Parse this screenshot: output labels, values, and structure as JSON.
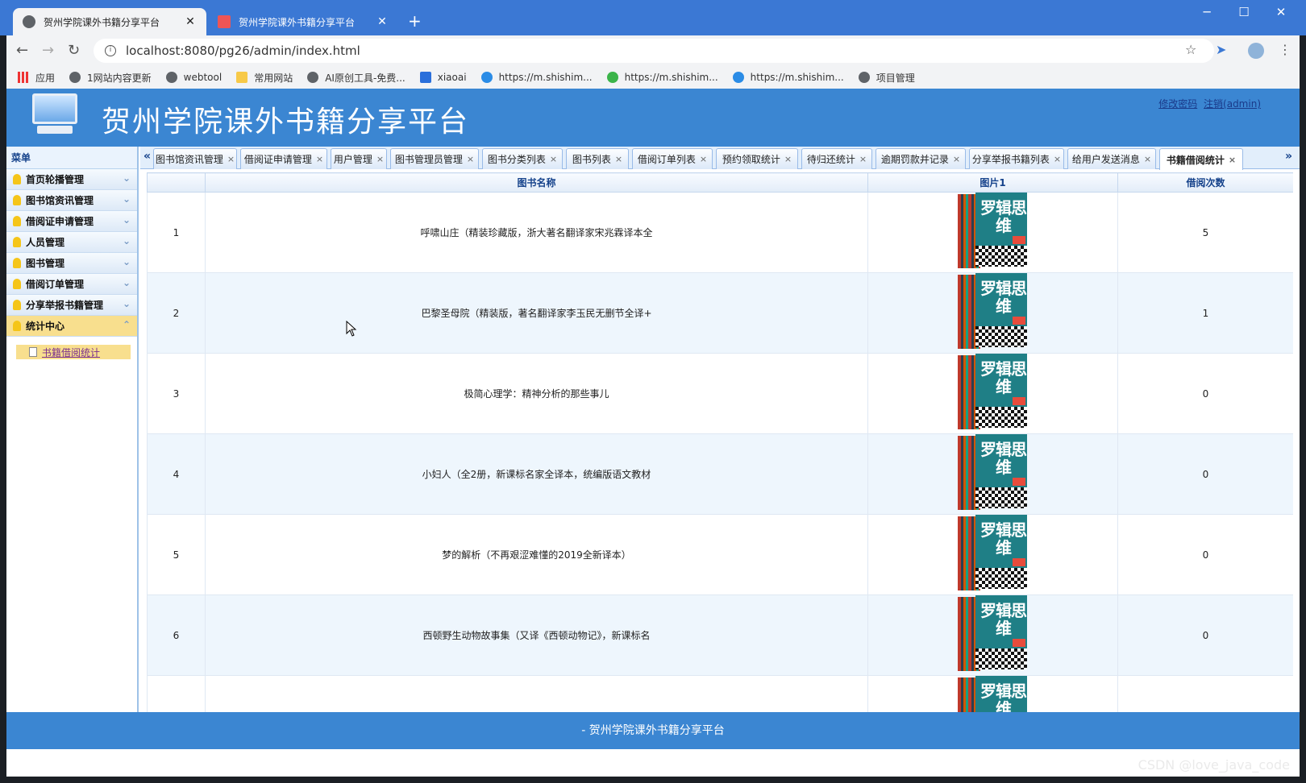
{
  "browser": {
    "tabs": [
      {
        "label": "贺州学院课外书籍分享平台",
        "active": true
      },
      {
        "label": "贺州学院课外书籍分享平台",
        "active": false
      }
    ],
    "url": "localhost:8080/pg26/admin/index.html",
    "bookmarks": [
      {
        "label": "应用",
        "icon": "apps-icon"
      },
      {
        "label": "1网站内容更新",
        "icon": "globe-icon"
      },
      {
        "label": "webtool",
        "icon": "globe-icon"
      },
      {
        "label": "常用网站",
        "icon": "folder-icon"
      },
      {
        "label": "AI原创工具-免费...",
        "icon": "globe-icon"
      },
      {
        "label": "xiaoai",
        "icon": "p-icon"
      },
      {
        "label": "https://m.shishim...",
        "icon": "c-icon"
      },
      {
        "label": "https://m.shishim...",
        "icon": "wechat-icon"
      },
      {
        "label": "https://m.shishim...",
        "icon": "c-icon"
      },
      {
        "label": "项目管理",
        "icon": "globe-icon"
      }
    ]
  },
  "header": {
    "title": "贺州学院课外书籍分享平台",
    "change_password": "修改密码",
    "logout": "注销(admin)"
  },
  "sidebar": {
    "title": "菜单",
    "items": [
      {
        "label": "首页轮播管理",
        "active": false
      },
      {
        "label": "图书馆资讯管理",
        "active": false
      },
      {
        "label": "借阅证申请管理",
        "active": false
      },
      {
        "label": "人员管理",
        "active": false
      },
      {
        "label": "图书管理",
        "active": false
      },
      {
        "label": "借阅订单管理",
        "active": false
      },
      {
        "label": "分享举报书籍管理",
        "active": false
      },
      {
        "label": "统计中心",
        "active": true
      }
    ],
    "submenu": [
      {
        "label": "书籍借阅统计"
      }
    ]
  },
  "page_tabs": [
    {
      "label": "图书馆资讯管理"
    },
    {
      "label": "借阅证申请管理"
    },
    {
      "label": "用户管理"
    },
    {
      "label": "图书管理员管理"
    },
    {
      "label": "图书分类列表"
    },
    {
      "label": "图书列表"
    },
    {
      "label": "借阅订单列表"
    },
    {
      "label": "预约领取统计"
    },
    {
      "label": "待归还统计"
    },
    {
      "label": "逾期罚款并记录"
    },
    {
      "label": "分享举报书籍列表"
    },
    {
      "label": "给用户发送消息"
    },
    {
      "label": "书籍借阅统计",
      "active": true
    }
  ],
  "table": {
    "columns": [
      "",
      "图书名称",
      "图片1",
      "借阅次数"
    ],
    "rows": [
      {
        "index": "1",
        "name": "呼啸山庄（精装珍藏版，浙大著名翻译家宋兆霖译本全",
        "count": "5"
      },
      {
        "index": "2",
        "name": "巴黎圣母院（精装版，著名翻译家李玉民无删节全译+",
        "count": "1"
      },
      {
        "index": "3",
        "name": "极简心理学：精神分析的那些事儿",
        "count": "0"
      },
      {
        "index": "4",
        "name": "小妇人（全2册，新课标名家全译本，统编版语文教材",
        "count": "0"
      },
      {
        "index": "5",
        "name": "梦的解析（不再艰涩难懂的2019全新译本）",
        "count": "0"
      },
      {
        "index": "6",
        "name": "西顿野生动物故事集（又译《西顿动物记》，新课标名",
        "count": "0"
      },
      {
        "index": "",
        "name": "",
        "count": ""
      }
    ],
    "cover_text": "罗辑思维"
  },
  "footer": {
    "text": "- 贺州学院课外书籍分享平台"
  },
  "watermark": "CSDN @love_java_code"
}
